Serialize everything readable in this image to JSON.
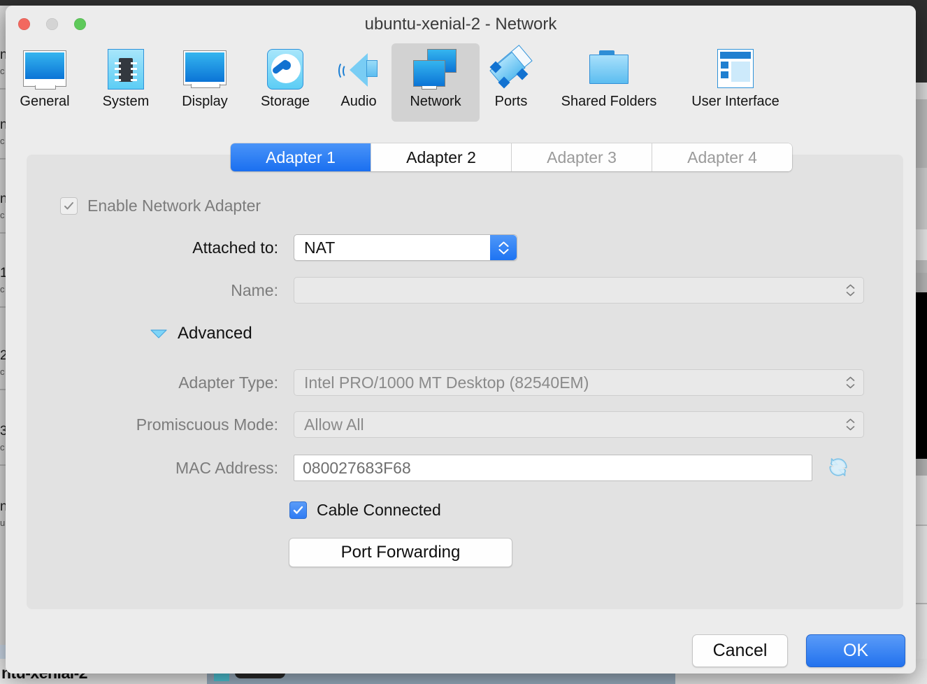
{
  "window": {
    "title": "ubuntu-xenial-2 - Network",
    "traffic_lights": [
      "close-button",
      "minimize-button",
      "maximize-button"
    ]
  },
  "toolbar": {
    "items": [
      {
        "label": "General",
        "icon": "general-icon",
        "selected": false
      },
      {
        "label": "System",
        "icon": "system-icon",
        "selected": false
      },
      {
        "label": "Display",
        "icon": "display-icon",
        "selected": false
      },
      {
        "label": "Storage",
        "icon": "storage-icon",
        "selected": false
      },
      {
        "label": "Audio",
        "icon": "audio-icon",
        "selected": false
      },
      {
        "label": "Network",
        "icon": "network-icon",
        "selected": true
      },
      {
        "label": "Ports",
        "icon": "ports-icon",
        "selected": false
      },
      {
        "label": "Shared Folders",
        "icon": "shared-folders-icon",
        "selected": false
      },
      {
        "label": "User Interface",
        "icon": "user-interface-icon",
        "selected": false
      }
    ]
  },
  "tabs": [
    {
      "label": "Adapter 1",
      "state": "active"
    },
    {
      "label": "Adapter 2",
      "state": "enabled"
    },
    {
      "label": "Adapter 3",
      "state": "disabled"
    },
    {
      "label": "Adapter 4",
      "state": "disabled"
    }
  ],
  "form": {
    "enable_adapter": {
      "label": "Enable Network Adapter",
      "checked": true,
      "enabled": false
    },
    "attached_to": {
      "label": "Attached to:",
      "value": "NAT",
      "enabled": true
    },
    "name": {
      "label": "Name:",
      "value": "",
      "enabled": false
    },
    "advanced": {
      "label": "Advanced",
      "expanded": true
    },
    "adapter_type": {
      "label": "Adapter Type:",
      "value": "Intel PRO/1000 MT Desktop (82540EM)",
      "enabled": false
    },
    "promiscuous_mode": {
      "label": "Promiscuous Mode:",
      "value": "Allow All",
      "enabled": false
    },
    "mac_address": {
      "label": "MAC Address:",
      "value": "080027683F68",
      "enabled": false,
      "refresh_icon": "refresh-icon"
    },
    "cable_connected": {
      "label": "Cable Connected",
      "checked": true,
      "enabled": true
    },
    "port_forwarding": {
      "label": "Port Forwarding"
    }
  },
  "footer": {
    "cancel_label": "Cancel",
    "ok_label": "OK"
  },
  "background": {
    "bottom_title": "ntu-xenial-2",
    "left_list_items": [
      "n",
      "n",
      "n",
      "1",
      "2",
      "3",
      "n"
    ]
  },
  "colors": {
    "accent_blue": "#2272ee",
    "tab_active_blue": "#1a6ff0",
    "window_bg": "#ececec",
    "panel_bg": "#e2e2e2",
    "disabled_text": "#8a8a8a",
    "label_text": "#7c7c7c",
    "icon_blue": "#0b74d6"
  }
}
